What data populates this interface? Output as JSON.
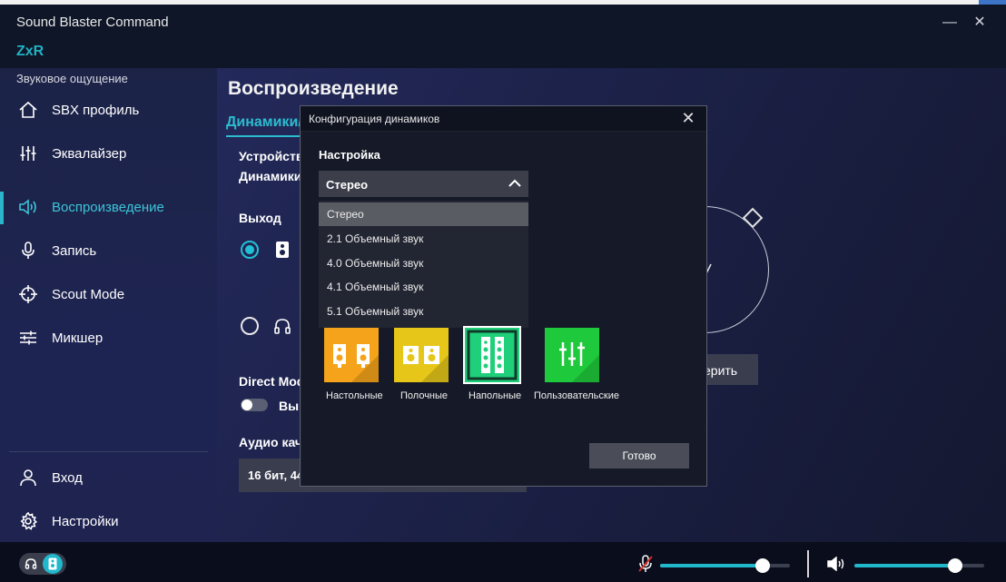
{
  "window": {
    "title": "Sound Blaster Command",
    "device": "ZxR",
    "minimize": "—",
    "close": "✕"
  },
  "sidebar": {
    "section_label": "Звуковое ощущение",
    "items": [
      {
        "label": "SBX профиль",
        "icon": "home-icon"
      },
      {
        "label": "Эквалайзер",
        "icon": "equalizer-icon"
      },
      {
        "label": "Воспроизведение",
        "icon": "speaker-icon",
        "active": true
      },
      {
        "label": "Запись",
        "icon": "microphone-icon"
      },
      {
        "label": "Scout Mode",
        "icon": "crosshair-icon"
      },
      {
        "label": "Микшер",
        "icon": "mixer-icon"
      }
    ],
    "bottom_items": [
      {
        "label": "Вход",
        "icon": "user-icon"
      },
      {
        "label": "Настройки",
        "icon": "gear-icon"
      }
    ]
  },
  "main": {
    "title": "Воспроизведение",
    "subtab": "Динамики/",
    "device_label_1": "Устройств",
    "device_label_2": "Динамики",
    "output_label": "Выход",
    "direct_mode_label": "Direct Mode",
    "direct_mode_toggle_text": "Вы",
    "direct_mode_on": false,
    "audio_quality_label": "Аудио кач",
    "audio_quality_value": "16 бит, 44",
    "test_button_partial": "ерить"
  },
  "dialog": {
    "title": "Конфигурация динамиков",
    "close": "✕",
    "setup_label": "Настройка",
    "selected": "Стерео",
    "options": [
      "Стерео",
      "2.1 Объемный звук",
      "4.0 Объемный звук",
      "4.1 Объемный звук",
      "5.1 Объемный звук"
    ],
    "speaker_types": [
      {
        "label": "Настольные",
        "color": "#f5a31a"
      },
      {
        "label": "Полочные",
        "color": "#e6c619"
      },
      {
        "label": "Напольные",
        "color": "#1fcf7a",
        "selected": true
      },
      {
        "label": "Пользовательские",
        "color": "#1fc93c"
      }
    ],
    "done_label": "Готово"
  },
  "bottombar": {
    "output_toggle": "speaker",
    "mic_muted": true,
    "mic_volume_percent": 82,
    "speaker_volume_percent": 78
  },
  "colors": {
    "accent": "#21b7cc",
    "sidebar_bg": "#1e2452",
    "dialog_bg": "#161a28"
  }
}
